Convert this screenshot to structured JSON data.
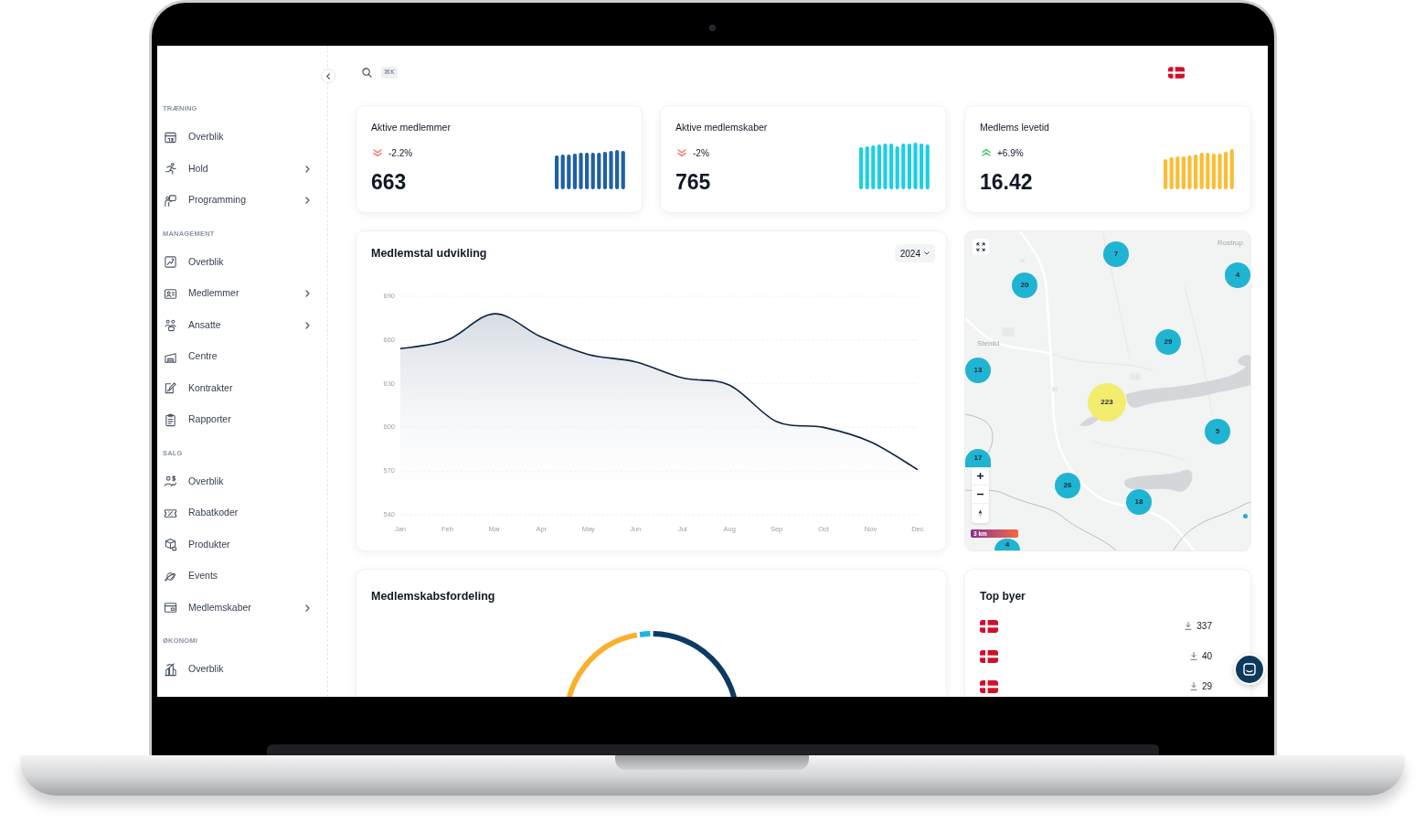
{
  "topbar": {
    "shortcut": "⌘K"
  },
  "sidebar": {
    "sections": [
      {
        "title": "TRÆNING",
        "items": [
          {
            "label": "Overblik",
            "submenu": false
          },
          {
            "label": "Hold",
            "submenu": true
          },
          {
            "label": "Programming",
            "submenu": true
          }
        ]
      },
      {
        "title": "MANAGEMENT",
        "items": [
          {
            "label": "Overblik",
            "submenu": false
          },
          {
            "label": "Medlemmer",
            "submenu": true
          },
          {
            "label": "Ansatte",
            "submenu": true
          },
          {
            "label": "Centre",
            "submenu": false
          },
          {
            "label": "Kontrakter",
            "submenu": false
          },
          {
            "label": "Rapporter",
            "submenu": false
          }
        ]
      },
      {
        "title": "SALG",
        "items": [
          {
            "label": "Overblik",
            "submenu": false
          },
          {
            "label": "Rabatkoder",
            "submenu": false
          },
          {
            "label": "Produkter",
            "submenu": false
          },
          {
            "label": "Events",
            "submenu": false
          },
          {
            "label": "Medlemskaber",
            "submenu": true
          }
        ]
      },
      {
        "title": "ØKONOMI",
        "items": [
          {
            "label": "Overblik",
            "submenu": false
          }
        ]
      }
    ]
  },
  "stat_cards": [
    {
      "title": "Aktive medlemmer",
      "rising": false,
      "change": "-2.2%",
      "value": "663",
      "color": "#1f5fa6"
    },
    {
      "title": "Aktive medlemskaber",
      "rising": false,
      "change": "-2%",
      "value": "765",
      "color": "#1ccfe4"
    },
    {
      "title": "Medlems levetid",
      "rising": true,
      "change": "+6.9%",
      "value": "16.42",
      "color": "#fbbd35"
    }
  ],
  "growth_chart": {
    "title": "Medlemstal udvikling",
    "year": "2024",
    "chart_data": {
      "type": "area",
      "categories": [
        "Jan",
        "Feb",
        "Mar",
        "Apr",
        "May",
        "Jun",
        "Jul",
        "Aug",
        "Sep",
        "Oct",
        "Nov",
        "Dec"
      ],
      "series": [
        {
          "color": "#0c2340",
          "values": [
            654,
            660,
            678,
            662,
            650,
            645,
            634,
            629,
            604,
            600,
            590,
            571
          ]
        }
      ],
      "ylim": [
        540,
        690
      ],
      "yticks": [
        540,
        570,
        600,
        630,
        660,
        690
      ],
      "grid": true
    }
  },
  "map": {
    "place_labels": [
      "Rostrup",
      "Stenild"
    ],
    "clusters": [
      {
        "count": "7",
        "color": "#20b4d3"
      },
      {
        "count": "4",
        "color": "#20b4d3"
      },
      {
        "count": "20",
        "color": "#20b4d3"
      },
      {
        "count": "29",
        "color": "#20b4d3"
      },
      {
        "count": "13",
        "color": "#20b4d3"
      },
      {
        "count": "223",
        "color": "#f2ec6f"
      },
      {
        "count": "5",
        "color": "#20b4d3"
      },
      {
        "count": "17",
        "color": "#20b4d3"
      },
      {
        "count": "26",
        "color": "#20b4d3"
      },
      {
        "count": "18",
        "color": "#20b4d3"
      },
      {
        "count": "4",
        "color": "#20b4d3"
      }
    ],
    "scale": "3 km"
  },
  "distribution": {
    "title": "Medlemskabsfordeling"
  },
  "top_cities": {
    "title": "Top byer",
    "rows": [
      {
        "count": "337"
      },
      {
        "count": "40"
      },
      {
        "count": "29"
      }
    ]
  }
}
